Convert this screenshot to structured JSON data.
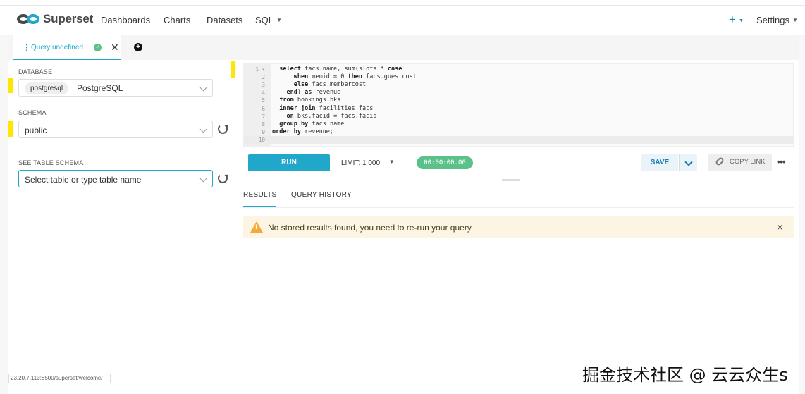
{
  "navbar": {
    "brand": "Superset",
    "items": [
      "Dashboards",
      "Charts",
      "Datasets",
      "SQL"
    ],
    "plus_label": "+",
    "settings_label": "Settings"
  },
  "tabs": [
    {
      "label": "Query undefined",
      "status": "success"
    }
  ],
  "left": {
    "database_label": "DATABASE",
    "database_tag": "postgresql",
    "database_name": "PostgreSQL",
    "schema_label": "SCHEMA",
    "schema_value": "public",
    "table_schema_label": "SEE TABLE SCHEMA",
    "table_placeholder": "Select table or type table name"
  },
  "editor": {
    "line_numbers": [
      "1",
      "2",
      "3",
      "4",
      "5",
      "6",
      "7",
      "8",
      "9",
      "10"
    ],
    "lines": [
      "  select facs.name, sum(slots * case",
      "      when memid = 0 then facs.guestcost",
      "      else facs.membercost",
      "    end) as revenue",
      "  from bookings bks",
      "  inner join facilities facs",
      "    on bks.facid = facs.facid",
      "  group by facs.name",
      "order by revenue;",
      ""
    ]
  },
  "toolbar": {
    "run_label": "RUN",
    "limit_label": "LIMIT:",
    "limit_value": "1 000",
    "timer": "00:00:00.00",
    "save_label": "SAVE",
    "copy_link_label": "COPY LINK",
    "more_label": "•••"
  },
  "results": {
    "tabs": [
      "RESULTS",
      "QUERY HISTORY"
    ],
    "alert_text": "No stored results found, you need to re-run your query"
  },
  "status_url": "23.20.7.113:8500/superset/welcome/",
  "watermark": "掘金技术社区 @ 云云众生s",
  "colors": {
    "primary": "#20a7c9",
    "success": "#5ac189",
    "warning": "#f3a93b",
    "alert_bg": "#fdf5e3",
    "highlight_marker": "#ffe600"
  },
  "icons": [
    "superset-logo-icon",
    "check-circle-icon",
    "close-icon",
    "add-tab-icon",
    "chevron-down-icon",
    "refresh-icon",
    "link-icon",
    "more-icon",
    "warning-icon"
  ]
}
